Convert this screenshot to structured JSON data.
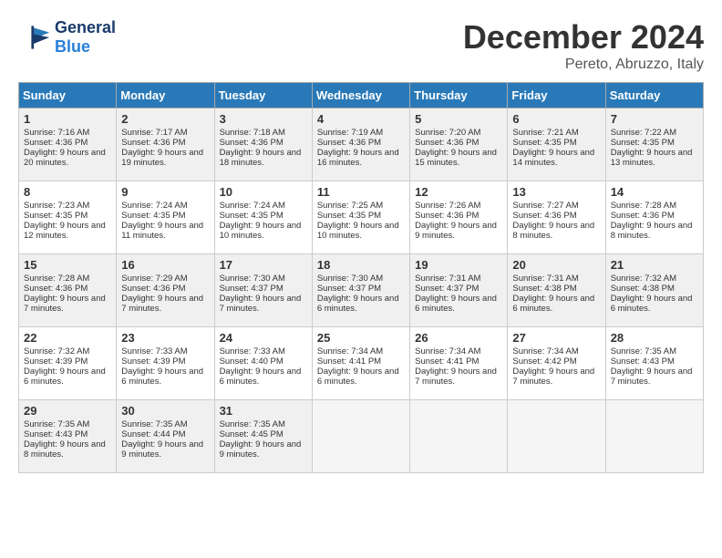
{
  "header": {
    "logo_general": "General",
    "logo_blue": "Blue",
    "month": "December 2024",
    "location": "Pereto, Abruzzo, Italy"
  },
  "days_of_week": [
    "Sunday",
    "Monday",
    "Tuesday",
    "Wednesday",
    "Thursday",
    "Friday",
    "Saturday"
  ],
  "weeks": [
    [
      {
        "day": "1",
        "sunrise": "7:16 AM",
        "sunset": "4:36 PM",
        "daylight": "9 hours and 20 minutes."
      },
      {
        "day": "2",
        "sunrise": "7:17 AM",
        "sunset": "4:36 PM",
        "daylight": "9 hours and 19 minutes."
      },
      {
        "day": "3",
        "sunrise": "7:18 AM",
        "sunset": "4:36 PM",
        "daylight": "9 hours and 18 minutes."
      },
      {
        "day": "4",
        "sunrise": "7:19 AM",
        "sunset": "4:36 PM",
        "daylight": "9 hours and 16 minutes."
      },
      {
        "day": "5",
        "sunrise": "7:20 AM",
        "sunset": "4:36 PM",
        "daylight": "9 hours and 15 minutes."
      },
      {
        "day": "6",
        "sunrise": "7:21 AM",
        "sunset": "4:35 PM",
        "daylight": "9 hours and 14 minutes."
      },
      {
        "day": "7",
        "sunrise": "7:22 AM",
        "sunset": "4:35 PM",
        "daylight": "9 hours and 13 minutes."
      }
    ],
    [
      {
        "day": "8",
        "sunrise": "7:23 AM",
        "sunset": "4:35 PM",
        "daylight": "9 hours and 12 minutes."
      },
      {
        "day": "9",
        "sunrise": "7:24 AM",
        "sunset": "4:35 PM",
        "daylight": "9 hours and 11 minutes."
      },
      {
        "day": "10",
        "sunrise": "7:24 AM",
        "sunset": "4:35 PM",
        "daylight": "9 hours and 10 minutes."
      },
      {
        "day": "11",
        "sunrise": "7:25 AM",
        "sunset": "4:35 PM",
        "daylight": "9 hours and 10 minutes."
      },
      {
        "day": "12",
        "sunrise": "7:26 AM",
        "sunset": "4:36 PM",
        "daylight": "9 hours and 9 minutes."
      },
      {
        "day": "13",
        "sunrise": "7:27 AM",
        "sunset": "4:36 PM",
        "daylight": "9 hours and 8 minutes."
      },
      {
        "day": "14",
        "sunrise": "7:28 AM",
        "sunset": "4:36 PM",
        "daylight": "9 hours and 8 minutes."
      }
    ],
    [
      {
        "day": "15",
        "sunrise": "7:28 AM",
        "sunset": "4:36 PM",
        "daylight": "9 hours and 7 minutes."
      },
      {
        "day": "16",
        "sunrise": "7:29 AM",
        "sunset": "4:36 PM",
        "daylight": "9 hours and 7 minutes."
      },
      {
        "day": "17",
        "sunrise": "7:30 AM",
        "sunset": "4:37 PM",
        "daylight": "9 hours and 7 minutes."
      },
      {
        "day": "18",
        "sunrise": "7:30 AM",
        "sunset": "4:37 PM",
        "daylight": "9 hours and 6 minutes."
      },
      {
        "day": "19",
        "sunrise": "7:31 AM",
        "sunset": "4:37 PM",
        "daylight": "9 hours and 6 minutes."
      },
      {
        "day": "20",
        "sunrise": "7:31 AM",
        "sunset": "4:38 PM",
        "daylight": "9 hours and 6 minutes."
      },
      {
        "day": "21",
        "sunrise": "7:32 AM",
        "sunset": "4:38 PM",
        "daylight": "9 hours and 6 minutes."
      }
    ],
    [
      {
        "day": "22",
        "sunrise": "7:32 AM",
        "sunset": "4:39 PM",
        "daylight": "9 hours and 6 minutes."
      },
      {
        "day": "23",
        "sunrise": "7:33 AM",
        "sunset": "4:39 PM",
        "daylight": "9 hours and 6 minutes."
      },
      {
        "day": "24",
        "sunrise": "7:33 AM",
        "sunset": "4:40 PM",
        "daylight": "9 hours and 6 minutes."
      },
      {
        "day": "25",
        "sunrise": "7:34 AM",
        "sunset": "4:41 PM",
        "daylight": "9 hours and 6 minutes."
      },
      {
        "day": "26",
        "sunrise": "7:34 AM",
        "sunset": "4:41 PM",
        "daylight": "9 hours and 7 minutes."
      },
      {
        "day": "27",
        "sunrise": "7:34 AM",
        "sunset": "4:42 PM",
        "daylight": "9 hours and 7 minutes."
      },
      {
        "day": "28",
        "sunrise": "7:35 AM",
        "sunset": "4:43 PM",
        "daylight": "9 hours and 7 minutes."
      }
    ],
    [
      {
        "day": "29",
        "sunrise": "7:35 AM",
        "sunset": "4:43 PM",
        "daylight": "9 hours and 8 minutes."
      },
      {
        "day": "30",
        "sunrise": "7:35 AM",
        "sunset": "4:44 PM",
        "daylight": "9 hours and 9 minutes."
      },
      {
        "day": "31",
        "sunrise": "7:35 AM",
        "sunset": "4:45 PM",
        "daylight": "9 hours and 9 minutes."
      },
      null,
      null,
      null,
      null
    ]
  ],
  "labels": {
    "sunrise": "Sunrise:",
    "sunset": "Sunset:",
    "daylight": "Daylight:"
  }
}
